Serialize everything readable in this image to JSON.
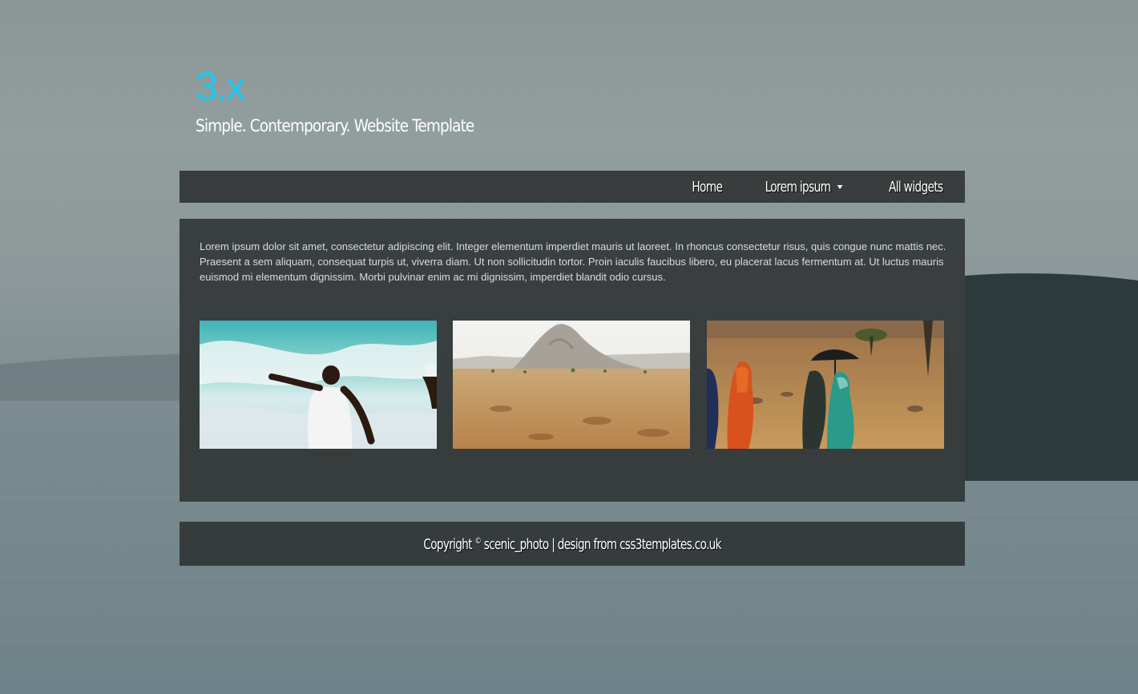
{
  "header": {
    "logo": "3.x",
    "tagline": "Simple. Contemporary. Website Template"
  },
  "nav": {
    "items": [
      {
        "label": "Home",
        "has_dropdown": false
      },
      {
        "label": "Lorem ipsum",
        "has_dropdown": true
      },
      {
        "label": "All widgets",
        "has_dropdown": false
      }
    ]
  },
  "main": {
    "intro": "Lorem ipsum dolor sit amet, consectetur adipiscing elit. Integer elementum imperdiet mauris ut laoreet. In rhoncus consectetur risus, quis congue nunc mattis nec. Praesent a sem aliquam, consequat turpis ut, viverra diam. Ut non sollicitudin tortor. Proin iaculis faucibus libero, eu placerat lacus fermentum at. Ut luctus mauris euismod mi elementum dignissim. Morbi pulvinar enim ac mi dignissim, imperdiet blandit odio cursus."
  },
  "footer": {
    "prefix": "Copyright",
    "symbol": "©",
    "owner": "scenic_photo",
    "separator": "|",
    "design_credit": "design from css3templates.co.uk"
  },
  "colors": {
    "logo": "#1ec8f0",
    "panel": "#2c3030",
    "text": "#ffffff"
  }
}
